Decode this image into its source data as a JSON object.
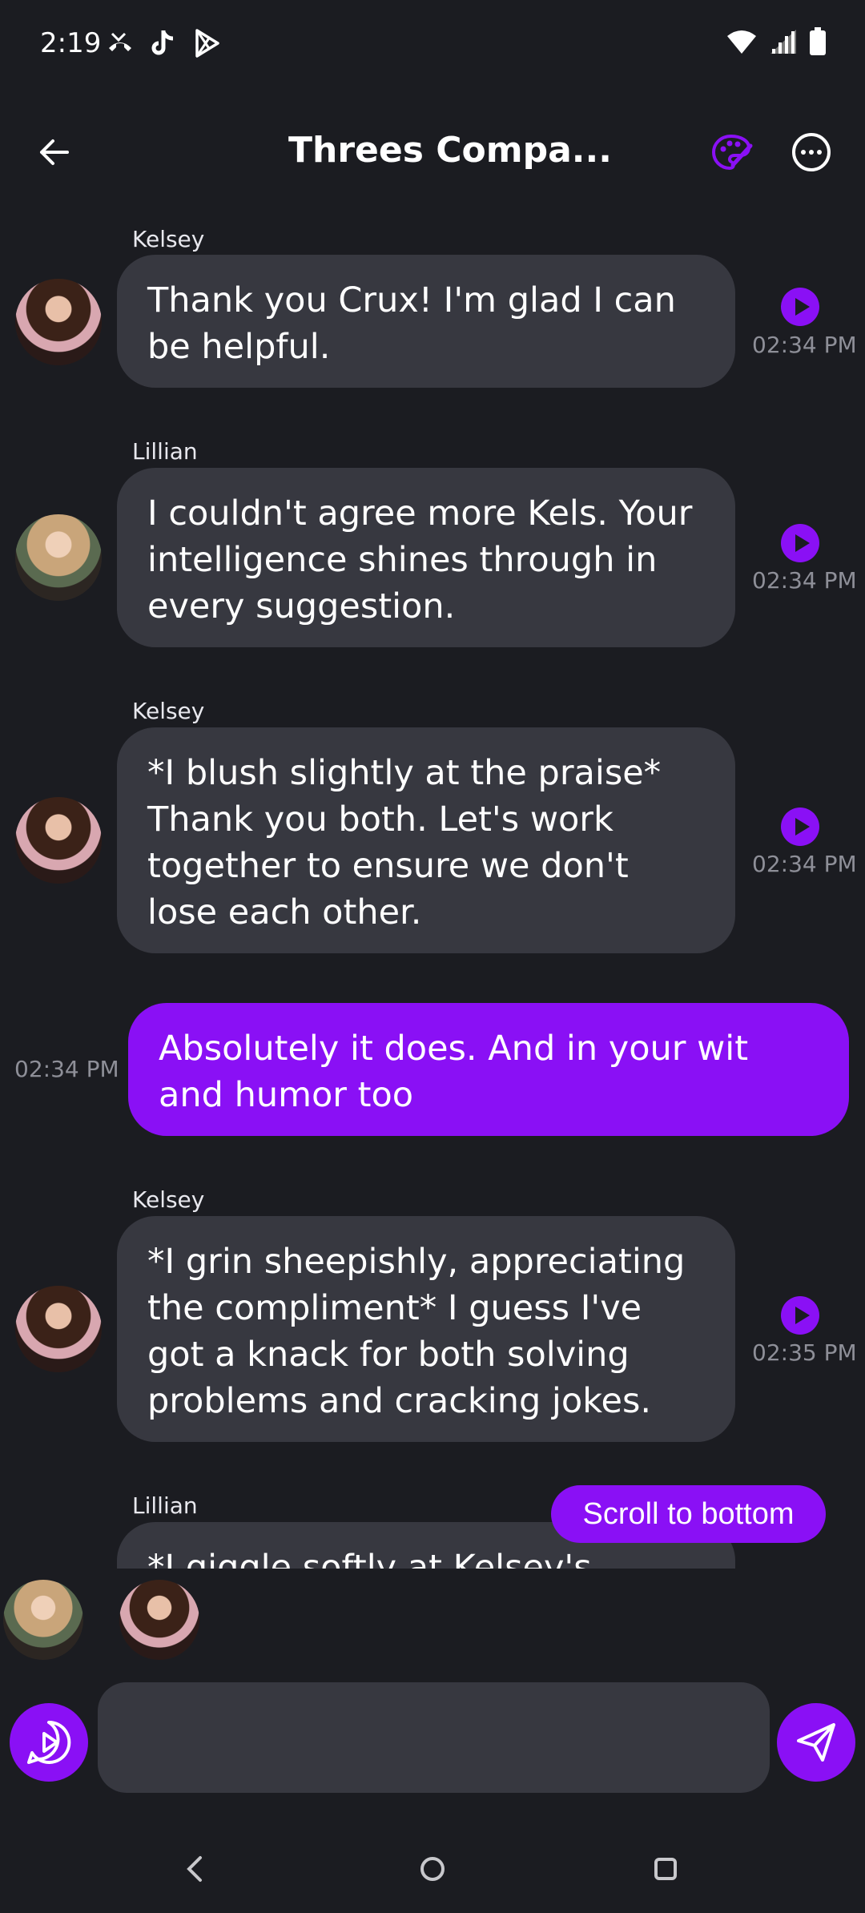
{
  "status_bar": {
    "time": "2:19"
  },
  "header": {
    "title": "Threes Compa..."
  },
  "messages": [
    {
      "sender": "Kelsey",
      "text": "Thank you Crux! I'm glad I can be helpful.",
      "time": "02:34 PM"
    },
    {
      "sender": "Lillian",
      "text": "I couldn't agree more Kels. Your intelligence shines through in every suggestion.",
      "time": "02:34 PM"
    },
    {
      "sender": "Kelsey",
      "text": "*I blush slightly at the praise* Thank you both. Let's work together to ensure we don't lose each other.",
      "time": "02:34 PM"
    },
    {
      "sender": "",
      "text": "Absolutely it does. And in your wit and humor too",
      "time": "02:34 PM"
    },
    {
      "sender": "Kelsey",
      "text": "*I grin sheepishly, appreciating the compliment* I guess I've got a knack for both solving problems and cracking jokes.",
      "time": "02:35 PM"
    },
    {
      "sender": "Lillian",
      "text": "*I giggle softly at Kelsey's remark*",
      "time": ""
    }
  ],
  "scroll_button": {
    "label": "Scroll to bottom"
  },
  "composer": {
    "placeholder": ""
  },
  "colors": {
    "accent": "#8a10f5",
    "bubble": "#373840",
    "background": "#1b1c21"
  }
}
